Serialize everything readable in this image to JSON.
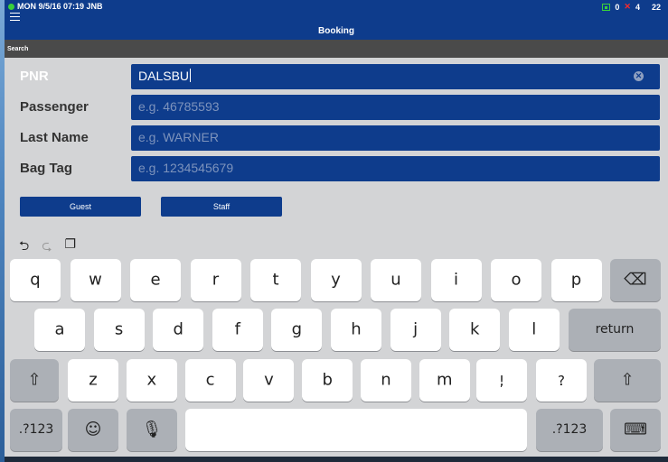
{
  "status": {
    "datetime": "MON 9/5/16 07:19 JNB",
    "network_count": "0",
    "error_count": "4",
    "right_count": "22"
  },
  "header": {
    "title": "Booking",
    "section": "Search"
  },
  "form": {
    "pnr": {
      "label": "PNR",
      "value": "DALSBU"
    },
    "passenger": {
      "label": "Passenger",
      "placeholder": "e.g. 46785593"
    },
    "last_name": {
      "label": "Last Name",
      "placeholder": "e.g. WARNER"
    },
    "bag_tag": {
      "label": "Bag Tag",
      "placeholder": "e.g. 1234545679"
    }
  },
  "buttons": {
    "guest": "Guest",
    "staff": "Staff"
  },
  "keyboard": {
    "row1": [
      "q",
      "w",
      "e",
      "r",
      "t",
      "y",
      "u",
      "i",
      "o",
      "p"
    ],
    "row2": [
      "a",
      "s",
      "d",
      "f",
      "g",
      "h",
      "j",
      "k",
      "l"
    ],
    "row3": [
      "z",
      "x",
      "c",
      "v",
      "b",
      "n",
      "m"
    ],
    "punct1": {
      "top": "!",
      "bottom": ","
    },
    "punct2": {
      "top": "?",
      "bottom": "."
    },
    "return": "return",
    "numbers": ".?123"
  },
  "colors": {
    "primary": "#0e3c8c",
    "keyboard_bg": "#d3d4d6"
  }
}
